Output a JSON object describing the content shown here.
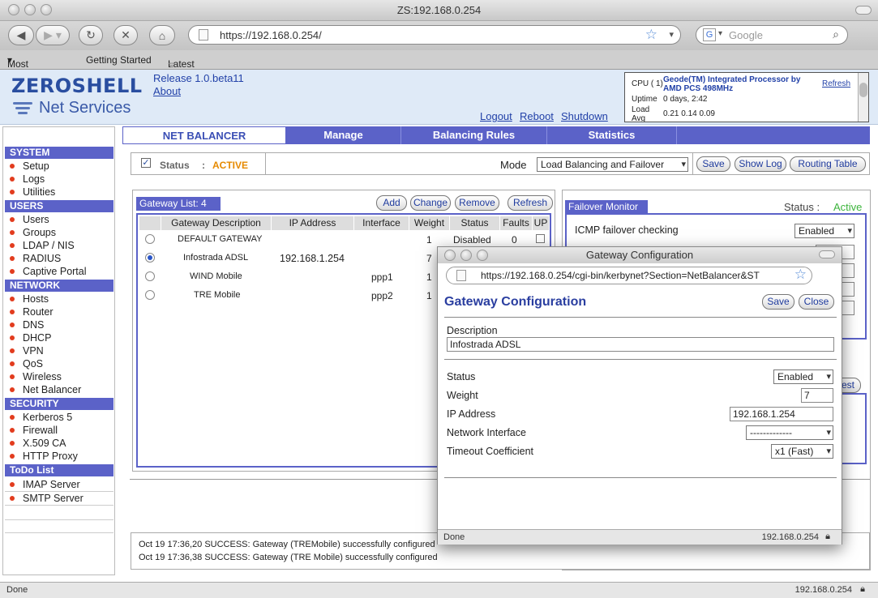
{
  "browser": {
    "window_title": "ZS:192.168.0.254",
    "url": "https://192.168.0.254/",
    "search_placeholder": "Google",
    "bookmarks": [
      "Most Visited",
      "Getting Started",
      "Latest Headlines"
    ],
    "status_left": "Done",
    "status_right": "192.168.0.254"
  },
  "header": {
    "logo_main": "ZEROSHELL",
    "logo_sub": "Net Services",
    "release": "Release 1.0.beta11",
    "about": "About",
    "logout": "Logout",
    "reboot": "Reboot",
    "shutdown": "Shutdown",
    "cpu_label": "CPU ( 1)",
    "cpu_value": "Geode(TM) Integrated Processor by AMD PCS 498MHz",
    "refresh": "Refresh",
    "uptime_label": "Uptime",
    "uptime_value": "0 days, 2:42",
    "load_label": "Load Avg",
    "load_value": "0.21 0.14 0.09"
  },
  "sidebar": {
    "sections": [
      {
        "title": "SYSTEM",
        "items": [
          "Setup",
          "Logs",
          "Utilities"
        ]
      },
      {
        "title": "USERS",
        "items": [
          "Users",
          "Groups",
          "LDAP / NIS",
          "RADIUS",
          "Captive Portal"
        ]
      },
      {
        "title": "NETWORK",
        "items": [
          "Hosts",
          "Router",
          "DNS",
          "DHCP",
          "VPN",
          "QoS",
          "Wireless",
          "Net Balancer"
        ]
      },
      {
        "title": "SECURITY",
        "items": [
          "Kerberos 5",
          "Firewall",
          "X.509 CA",
          "HTTP Proxy"
        ]
      },
      {
        "title": "ToDo List",
        "items": [
          "IMAP Server",
          "SMTP Server"
        ]
      }
    ]
  },
  "tabs": [
    "NET BALANCER",
    "Manage",
    "Balancing Rules",
    "Statistics"
  ],
  "statusbar": {
    "status_label": "Status",
    "colon": ":",
    "status_value": "ACTIVE",
    "mode_label": "Mode",
    "mode_value": "Load Balancing and Failover",
    "save": "Save",
    "show_log": "Show Log",
    "routing_table": "Routing Table"
  },
  "gateways": {
    "title": "Gateway List:  4",
    "add": "Add",
    "change": "Change",
    "remove": "Remove",
    "refresh": "Refresh",
    "columns": [
      "Gateway Description",
      "IP Address",
      "Interface",
      "Weight",
      "Status",
      "Faults",
      "UP"
    ],
    "rows": [
      {
        "desc": "DEFAULT GATEWAY",
        "ip": "",
        "iface": "",
        "weight": "1",
        "status": "Disabled",
        "faults": "0",
        "selected": false
      },
      {
        "desc": "Infostrada ADSL",
        "ip": "192.168.1.254",
        "iface": "",
        "weight": "7",
        "status": "",
        "faults": "",
        "selected": true
      },
      {
        "desc": "WIND Mobile",
        "ip": "",
        "iface": "ppp1",
        "weight": "1",
        "status": "",
        "faults": "",
        "selected": false
      },
      {
        "desc": "TRE Mobile",
        "ip": "",
        "iface": "ppp2",
        "weight": "1",
        "status": "",
        "faults": "",
        "selected": false
      }
    ]
  },
  "failover": {
    "title": "Failover Monitor",
    "status_label": "Status :",
    "status_value": "Active",
    "icmp_label": "ICMP failover checking",
    "icmp_value": "Enabled",
    "test_label": "Test"
  },
  "log": {
    "lines": [
      "Oct 19 17:36,20 SUCCESS: Gateway (TREMobile) successfully configured",
      "Oct 19 17:36,38 SUCCESS: Gateway (TRE Mobile) successfully configured"
    ]
  },
  "popup": {
    "window_title": "Gateway Configuration",
    "url": "https://192.168.0.254/cgi-bin/kerbynet?Section=NetBalancer&ST",
    "heading": "Gateway Configuration",
    "save": "Save",
    "close": "Close",
    "description_label": "Description",
    "description_value": "Infostrada  ADSL",
    "status_label": "Status",
    "status_value": "Enabled",
    "weight_label": "Weight",
    "weight_value": "7",
    "ip_label": "IP Address",
    "ip_value": "192.168.1.254",
    "iface_label": "Network Interface",
    "iface_value": "-------------",
    "timeout_label": "Timeout Coefficient",
    "timeout_value": "x1 (Fast)",
    "status_left": "Done",
    "status_right": "192.168.0.254"
  }
}
